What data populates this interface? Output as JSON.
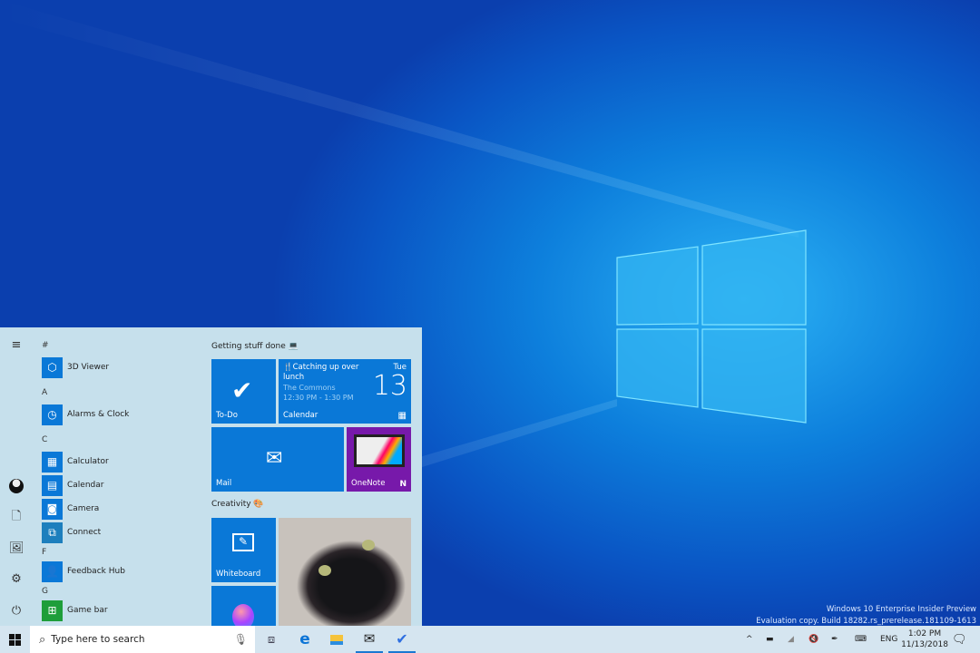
{
  "watermark": {
    "line1": "Windows 10 Enterprise Insider Preview",
    "line2": "Evaluation copy. Build 18282.rs_prerelease.181109-1613"
  },
  "start_menu": {
    "rail": [
      {
        "icon": "hamburger-icon"
      },
      {
        "icon": "user-avatar"
      },
      {
        "icon": "document-icon"
      },
      {
        "icon": "pictures-icon"
      },
      {
        "icon": "settings-gear-icon"
      },
      {
        "icon": "power-icon"
      }
    ],
    "app_list": [
      {
        "header": "#"
      },
      {
        "label": "3D Viewer",
        "icon": "cube-icon"
      },
      {
        "header": "A"
      },
      {
        "label": "Alarms & Clock",
        "icon": "alarm-clock-icon"
      },
      {
        "header": "C"
      },
      {
        "label": "Calculator",
        "icon": "calculator-icon"
      },
      {
        "label": "Calendar",
        "icon": "calendar-icon"
      },
      {
        "label": "Camera",
        "icon": "camera-icon"
      },
      {
        "label": "Connect",
        "icon": "connect-icon"
      },
      {
        "header": "F"
      },
      {
        "label": "Feedback Hub",
        "icon": "feedback-icon"
      },
      {
        "header": "G"
      },
      {
        "label": "Game bar",
        "icon": "game-bar-icon"
      }
    ],
    "groups": {
      "g1": "Getting stuff done 💻",
      "g2": "Creativity 🎨"
    },
    "tiles": {
      "todo": "To-Do",
      "calendar": {
        "label": "Calendar",
        "event": "🍴Catching up over lunch",
        "location": "The Commons",
        "time": "12:30 PM - 1:30 PM",
        "day": "Tue",
        "date": "13"
      },
      "mail": "Mail",
      "onenote": "OneNote",
      "whiteboard": "Whiteboard"
    },
    "colors": {
      "tile": "#0a78d7",
      "onenote": "#7719aa",
      "menu_bg": "#c6e0ec"
    }
  },
  "taskbar": {
    "search_placeholder": "Type here to search",
    "pinned": [
      "task-view",
      "edge",
      "file-explorer",
      "mail",
      "to-do"
    ],
    "tray": {
      "language": "ENG",
      "time": "1:02 PM",
      "date": "11/13/2018"
    }
  }
}
